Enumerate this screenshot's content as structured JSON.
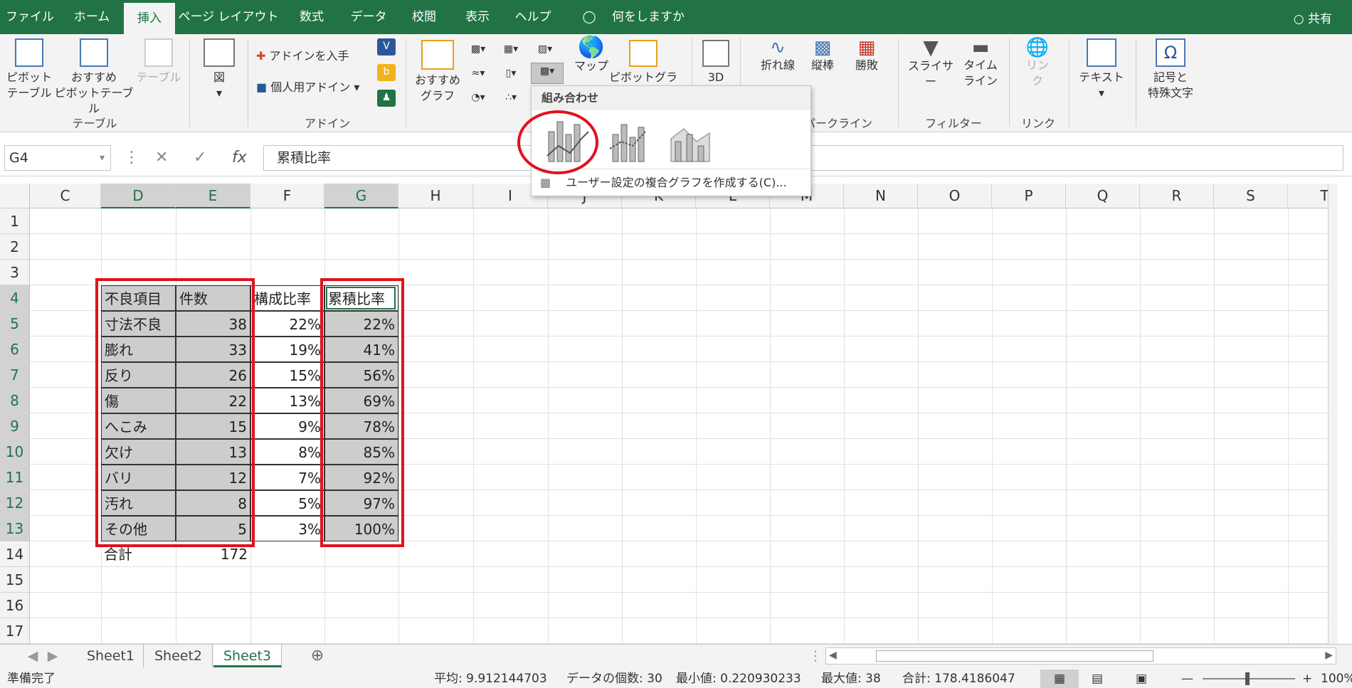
{
  "tabs": [
    "ファイル",
    "ホーム",
    "挿入",
    "ページ レイアウト",
    "数式",
    "データ",
    "校閲",
    "表示",
    "ヘルプ",
    "何をしますか"
  ],
  "share_label": "共有",
  "ribbon": {
    "pivot_table": [
      "ピボット",
      "テーブル"
    ],
    "recommended_pivot": [
      "おすすめ",
      "ピボットテーブル"
    ],
    "table": "テーブル",
    "group_table": "テーブル",
    "illustrations": "図",
    "get_addins": "アドインを入手",
    "my_addins": "個人用アドイン",
    "group_addins": "アドイン",
    "recommended_charts": [
      "おすすめ",
      "グラフ"
    ],
    "maps": "マップ",
    "pivot_chart": "ピボットグラフ",
    "threed": "3D",
    "line": "折れ線",
    "column": "縦棒",
    "winloss": "勝敗",
    "group_sparklines": "スパークライン",
    "slicer": "スライサー",
    "timeline": [
      "タイム",
      "ライン"
    ],
    "group_filter": "フィルター",
    "link": [
      "リン",
      "ク"
    ],
    "group_link": "リンク",
    "text": "テキスト",
    "symbols": [
      "記号と",
      "特殊文字"
    ]
  },
  "dropdown": {
    "title": "組み合わせ",
    "custom_link": "ユーザー設定の複合グラフを作成する(C)..."
  },
  "name_box": "G4",
  "formula": "累積比率",
  "columns": [
    "C",
    "D",
    "E",
    "F",
    "G",
    "H",
    "I",
    "J",
    "K",
    "L",
    "M",
    "N",
    "O",
    "P",
    "Q",
    "R",
    "S",
    "T"
  ],
  "rows": [
    "1",
    "2",
    "3",
    "4",
    "5",
    "6",
    "7",
    "8",
    "9",
    "10",
    "11",
    "12",
    "13",
    "14",
    "15",
    "16",
    "17"
  ],
  "table": {
    "headers": [
      "不良項目",
      "件数",
      "構成比率",
      "累積比率"
    ],
    "rows": [
      [
        "寸法不良",
        "38",
        "22%",
        "22%"
      ],
      [
        "膨れ",
        "33",
        "19%",
        "41%"
      ],
      [
        "反り",
        "26",
        "15%",
        "56%"
      ],
      [
        "傷",
        "22",
        "13%",
        "69%"
      ],
      [
        "へこみ",
        "15",
        "9%",
        "78%"
      ],
      [
        "欠け",
        "13",
        "8%",
        "85%"
      ],
      [
        "バリ",
        "12",
        "7%",
        "92%"
      ],
      [
        "汚れ",
        "8",
        "5%",
        "97%"
      ],
      [
        "その他",
        "5",
        "3%",
        "100%"
      ]
    ],
    "total_label": "合計",
    "total_value": "172"
  },
  "sheets": [
    "Sheet1",
    "Sheet2",
    "Sheet3"
  ],
  "status": {
    "ready": "準備完了",
    "average": "平均: 9.912144703",
    "count": "データの個数: 30",
    "min": "最小値: 0.220930233",
    "max": "最大値: 38",
    "sum": "合計: 178.4186047",
    "zoom": "100%"
  }
}
